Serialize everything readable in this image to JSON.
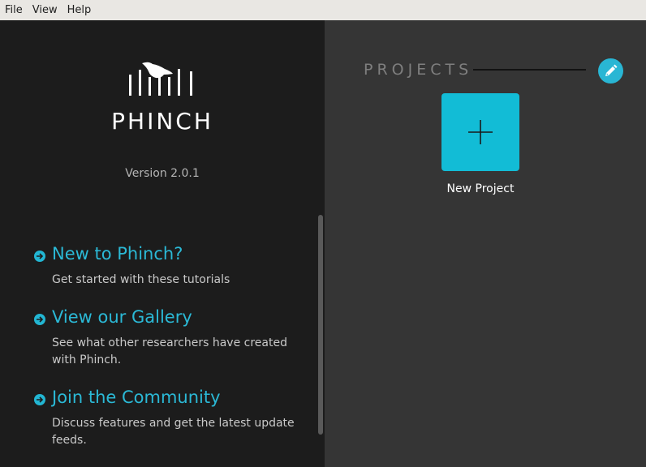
{
  "menu": {
    "file": "File",
    "view": "View",
    "help": "Help"
  },
  "brand": {
    "name": "PHINCH",
    "version": "Version 2.0.1"
  },
  "links": [
    {
      "title": "New to Phinch?",
      "description": "Get started with these tutorials"
    },
    {
      "title": "View our Gallery",
      "description": "See what other researchers have created with Phinch."
    },
    {
      "title": "Join the Community",
      "description": "Discuss features and get the latest update feeds."
    }
  ],
  "projects": {
    "heading": "PROJECTS",
    "new_project_label": "New Project"
  },
  "colors": {
    "accent": "#2bb9d6",
    "tile": "#12bcd6",
    "left_panel": "#1c1c1c",
    "right_panel": "#353535"
  },
  "icons": {
    "edit": "pencil-icon",
    "add": "plus-icon",
    "bullet": "arrow-right-circle-icon",
    "logo": "bird-on-bars-logo"
  }
}
